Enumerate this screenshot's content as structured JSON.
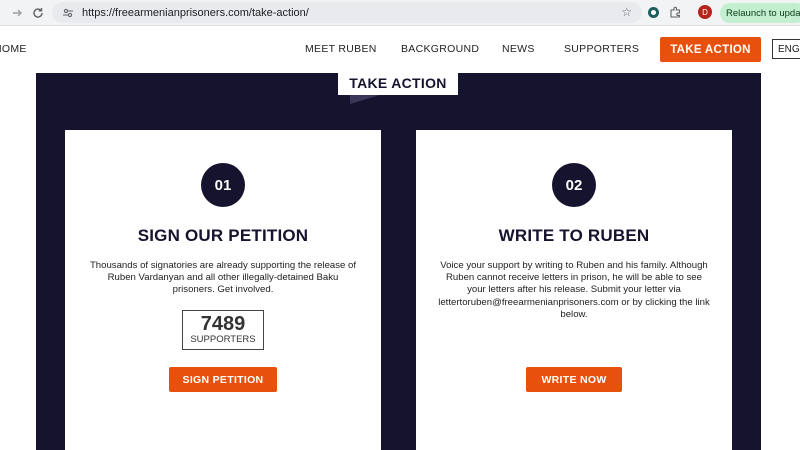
{
  "browser": {
    "url": "https://freearmenianprisoners.com/take-action/",
    "avatar_letter": "D",
    "relaunch_label": "Relaunch to update"
  },
  "header": {
    "home": "HOME",
    "nav": [
      "MEET RUBEN",
      "BACKGROUND",
      "NEWS",
      "SUPPORTERS"
    ],
    "cta": "TAKE ACTION",
    "lang": "ENG"
  },
  "section": {
    "title": "TAKE ACTION"
  },
  "cards": [
    {
      "number": "01",
      "title": "SIGN OUR PETITION",
      "text": "Thousands of signatories are already supporting the release of Ruben Vardanyan and all other illegally-detained Baku prisoners. Get involved.",
      "counter_value": "7489",
      "counter_label": "SUPPORTERS",
      "button": "SIGN PETITION"
    },
    {
      "number": "02",
      "title": "WRITE TO RUBEN",
      "text": "Voice your support by writing to Ruben and his family. Although Ruben cannot receive letters in prison, he will be able to see your letters after his release. Submit your letter via lettertoruben@freearmenianprisoners.com or by clicking the link below.",
      "button": "WRITE NOW"
    }
  ],
  "colors": {
    "accent": "#e8500e",
    "navy": "#15132e"
  }
}
